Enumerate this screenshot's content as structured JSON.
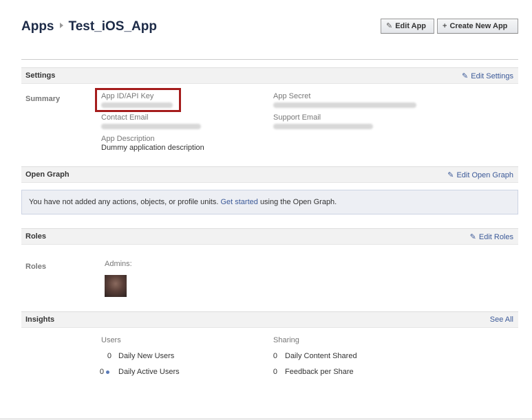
{
  "breadcrumb": {
    "root": "Apps",
    "app_name": "Test_iOS_App"
  },
  "toolbar": {
    "edit_app": "Edit App",
    "create_new_app": "Create New App"
  },
  "settings": {
    "title": "Settings",
    "edit_link": "Edit Settings",
    "summary_label": "Summary",
    "app_id_label": "App ID/API Key",
    "app_secret_label": "App Secret",
    "contact_email_label": "Contact Email",
    "support_email_label": "Support Email",
    "app_description_label": "App Description",
    "app_description_value": "Dummy application description"
  },
  "open_graph": {
    "title": "Open Graph",
    "edit_link": "Edit Open Graph",
    "message_prefix": "You have not added any actions, objects, or profile units.",
    "message_link": "Get started",
    "message_suffix": "using the Open Graph."
  },
  "roles": {
    "title": "Roles",
    "edit_link": "Edit Roles",
    "side_label": "Roles",
    "admins_label": "Admins:"
  },
  "insights": {
    "title": "Insights",
    "see_all": "See All",
    "users_heading": "Users",
    "sharing_heading": "Sharing",
    "daily_new_users_count": "0",
    "daily_new_users_label": "Daily New Users",
    "daily_active_users_count": "0",
    "daily_active_users_label": "Daily Active Users",
    "daily_content_shared_count": "0",
    "daily_content_shared_label": "Daily Content Shared",
    "feedback_per_share_count": "0",
    "feedback_per_share_label": "Feedback per Share"
  },
  "icons": {
    "pencil": "pencil-icon",
    "plus": "plus-icon",
    "breadcrumb_arrow": "triangle-right-icon",
    "info_dot": "info-dot-icon"
  },
  "colors": {
    "link": "#3b5998",
    "highlight_box": "#a51c1c",
    "section_header": "#f2f2f2",
    "og_box": "#edeff4"
  }
}
